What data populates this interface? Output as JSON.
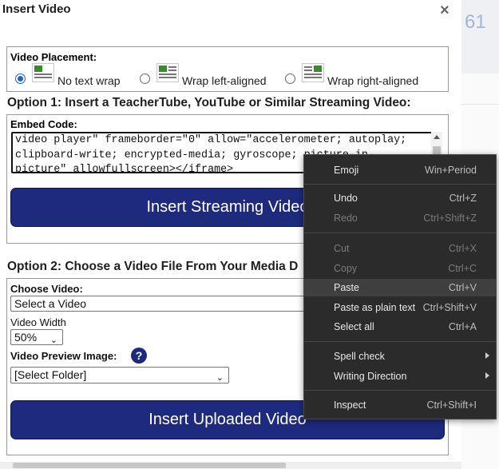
{
  "dialog": {
    "title": "Insert Video",
    "close_label": "×"
  },
  "background": {
    "partial_text": "61"
  },
  "placement": {
    "title": "Video Placement:",
    "options": [
      {
        "label": "No text wrap",
        "checked": true,
        "icon": "no-wrap-icon"
      },
      {
        "label": "Wrap left-aligned",
        "checked": false,
        "icon": "wrap-left-icon"
      },
      {
        "label": "Wrap right-aligned",
        "checked": false,
        "icon": "wrap-right-icon"
      }
    ]
  },
  "option1": {
    "title": "Option 1: Insert a TeacherTube, YouTube or Similar Streaming Video:",
    "embed_label": "Embed Code:",
    "embed_value": "video player\" frameborder=\"0\" allow=\"accelerometer; autoplay;\nclipboard-write; encrypted-media; gyroscope; picture-in-\npicture\" allowfullscreen></iframe>",
    "button_label": "Insert Streaming Video"
  },
  "option2": {
    "title": "Option 2: Choose a Video File From Your Media D",
    "choose_label": "Choose Video:",
    "choose_value": "Select a Video",
    "width_label": "Video Width",
    "width_value": "50%",
    "preview_label": "Video Preview Image:",
    "help_label": "?",
    "folder_value": "[Select Folder]",
    "button_label": "Insert Uploaded Video"
  },
  "context_menu": {
    "items": [
      {
        "label": "Emoji",
        "shortcut": "Win+Period",
        "disabled": false
      },
      {
        "label": "Undo",
        "shortcut": "Ctrl+Z",
        "disabled": false
      },
      {
        "label": "Redo",
        "shortcut": "Ctrl+Shift+Z",
        "disabled": true
      },
      {
        "label": "Cut",
        "shortcut": "Ctrl+X",
        "disabled": true
      },
      {
        "label": "Copy",
        "shortcut": "Ctrl+C",
        "disabled": true
      },
      {
        "label": "Paste",
        "shortcut": "Ctrl+V",
        "disabled": false,
        "highlighted": true
      },
      {
        "label": "Paste as plain text",
        "shortcut": "Ctrl+Shift+V",
        "disabled": false
      },
      {
        "label": "Select all",
        "shortcut": "Ctrl+A",
        "disabled": false
      },
      {
        "label": "Spell check",
        "submenu": true
      },
      {
        "label": "Writing Direction",
        "submenu": true
      },
      {
        "label": "Inspect",
        "shortcut": "Ctrl+Shift+I",
        "disabled": false
      }
    ]
  },
  "colors": {
    "button_bg": "#1d2a7e",
    "radio_accent": "#1a62d6",
    "menu_bg": "#2b2b2b"
  }
}
